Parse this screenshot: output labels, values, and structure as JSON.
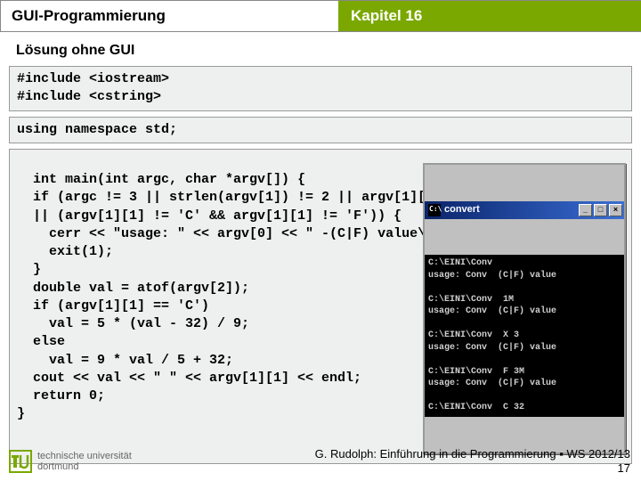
{
  "header": {
    "left": "GUI-Programmierung",
    "right": "Kapitel 16"
  },
  "subtitle": "Lösung ohne GUI",
  "code": {
    "block1": "#include <iostream>\n#include <cstring>",
    "block2": "using namespace std;",
    "block3": "int main(int argc, char *argv[]) {\n  if (argc != 3 || strlen(argv[1]) != 2 || argv[1][0] != '-,\n  || (argv[1][1] != 'C' && argv[1][1] != 'F')) {\n    cerr << \"usage: \" << argv[0] << \" -(C|F) value\\n\";\n    exit(1);\n  }\n  double val = atof(argv[2]);\n  if (argv[1][1] == 'C')\n    val = 5 * (val - 32) / 9;\n  else\n    val = 9 * val / 5 + 32;\n  cout << val << \" \" << argv[1][1] << endl;\n  return 0;\n}"
  },
  "console": {
    "title": "convert",
    "body": "C:\\EINI\\Conv\nusage: Conv  (C|F) value\n\nC:\\EINI\\Conv  1M\nusage: Conv  (C|F) value\n\nC:\\EINI\\Conv  X 3\nusage: Conv  (C|F) value\n\nC:\\EINI\\Conv  F 3M\nusage: Conv  (C|F) value\n\nC:\\EINI\\Conv  C 32"
  },
  "footer": {
    "uni_line1": "technische universität",
    "uni_line2": "dortmund",
    "credit": "G. Rudolph: Einführung in die Programmierung ▪ WS 2012/13",
    "page": "17"
  }
}
